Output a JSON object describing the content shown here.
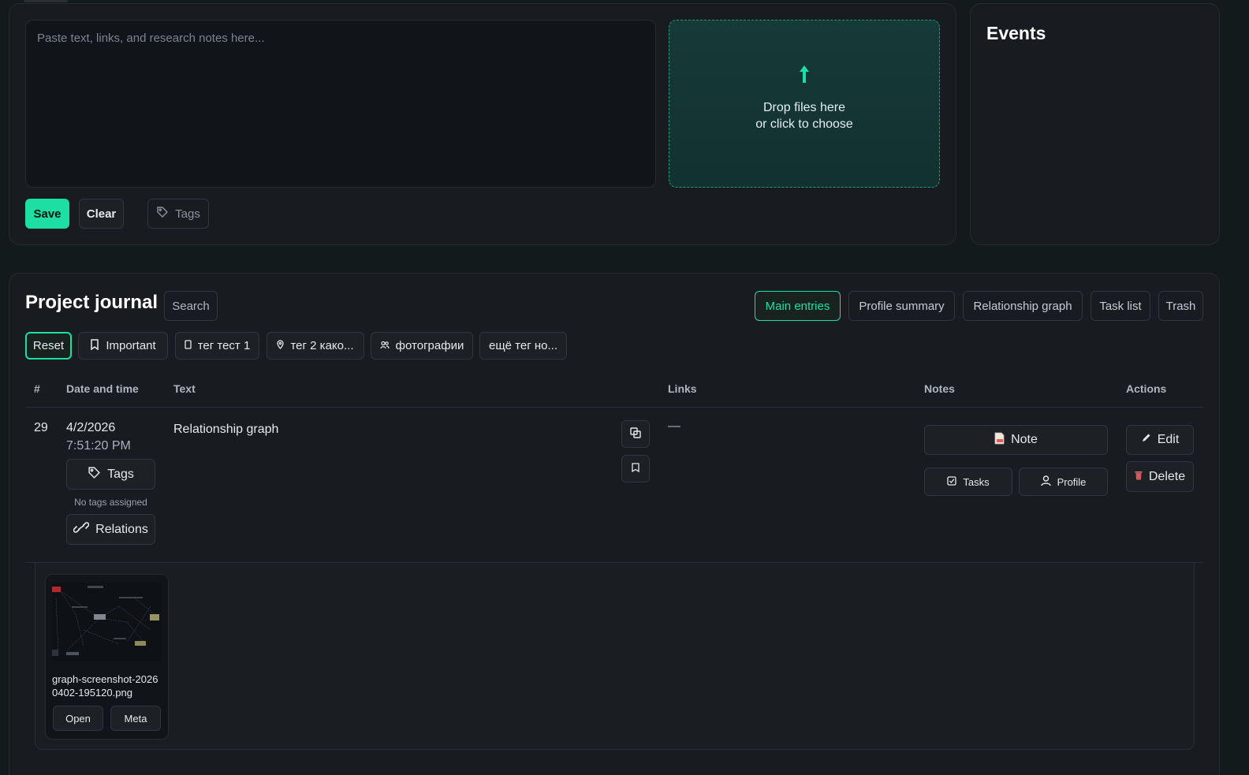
{
  "composer": {
    "placeholder": "Paste text, links, and research notes here...",
    "dropzone_line1": "Drop files here",
    "dropzone_line2": "or click to choose",
    "save_label": "Save",
    "clear_label": "Clear",
    "tags_label": "Tags"
  },
  "events": {
    "title": "Events"
  },
  "journal": {
    "title": "Project journal",
    "search_label": "Search",
    "tabs": [
      "Main entries",
      "Profile summary",
      "Relationship graph",
      "Task list",
      "Trash"
    ],
    "filters": {
      "reset": "Reset",
      "items": [
        "Important",
        "тег тест 1",
        "тег 2 како...",
        "фотографии",
        "ещё тег но..."
      ]
    },
    "columns": [
      "#",
      "Date and time",
      "Text",
      "Links",
      "Notes",
      "Actions"
    ],
    "entry": {
      "number": "29",
      "date": "4/2/2026",
      "time": "7:51:20 PM",
      "text": "Relationship graph",
      "links": "—",
      "tags_button": "Tags",
      "no_tags": "No tags assigned",
      "relations_button": "Relations",
      "note_button": "Note",
      "tasks_button": "Tasks",
      "profile_button": "Profile",
      "edit_button": "Edit",
      "delete_button": "Delete"
    },
    "attachment": {
      "filename": "graph-screenshot-20260402-195120.png",
      "open_label": "Open",
      "meta_label": "Meta"
    }
  },
  "colors": {
    "accent": "#1ddfa3",
    "background": "#121a1b",
    "panel": "#181c20"
  }
}
